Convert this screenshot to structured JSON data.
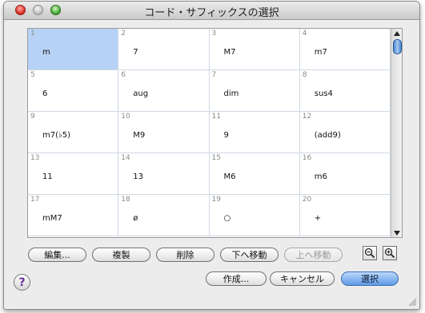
{
  "window": {
    "title": "コード・サフィックスの選択"
  },
  "grid": {
    "cells": [
      {
        "num": "1",
        "label": "m"
      },
      {
        "num": "2",
        "label": "7"
      },
      {
        "num": "3",
        "label": "M7"
      },
      {
        "num": "4",
        "label": "m7"
      },
      {
        "num": "5",
        "label": "6"
      },
      {
        "num": "6",
        "label": "aug"
      },
      {
        "num": "7",
        "label": "dim"
      },
      {
        "num": "8",
        "label": "sus4"
      },
      {
        "num": "9",
        "label": "m7(♭5)"
      },
      {
        "num": "10",
        "label": "M9"
      },
      {
        "num": "11",
        "label": "9"
      },
      {
        "num": "12",
        "label": "(add9)"
      },
      {
        "num": "13",
        "label": "11"
      },
      {
        "num": "14",
        "label": "13"
      },
      {
        "num": "15",
        "label": "M6"
      },
      {
        "num": "16",
        "label": "m6"
      },
      {
        "num": "17",
        "label": "mM7"
      },
      {
        "num": "18",
        "label": "ø"
      },
      {
        "num": "19",
        "label": "○"
      },
      {
        "num": "20",
        "label": "+"
      }
    ],
    "selected_index": 0
  },
  "buttons": {
    "edit": "編集...",
    "duplicate": "複製",
    "delete": "削除",
    "move_down": "下へ移動",
    "move_up": "上へ移動",
    "create": "作成...",
    "cancel": "キャンセル",
    "select": "選択"
  },
  "help": {
    "label": "?"
  },
  "colors": {
    "selection": "#b6d2f6",
    "default_button": "#5f9ae6"
  }
}
